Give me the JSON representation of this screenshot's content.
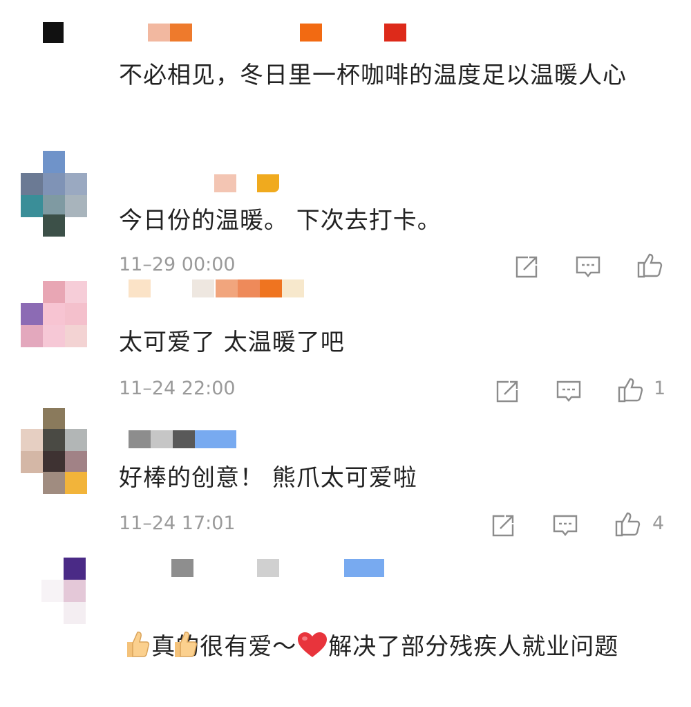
{
  "colors": {
    "text": "#222222",
    "meta": "#9a9a9a",
    "icon": "#8c8c8c",
    "heart": "#e8343c"
  },
  "comments": [
    {
      "text": "不必相见，冬日里一杯咖啡的温度足以温暖人心",
      "time": "",
      "likes": ""
    },
    {
      "text": "今日份的温暖。 下次去打卡。",
      "time": "11–29 00:00",
      "likes": "",
      "icons": [
        "share-icon",
        "comment-icon",
        "like-icon"
      ]
    },
    {
      "text": "太可爱了 太温暖了吧",
      "time": "11–24 22:00",
      "likes": "1",
      "icons": [
        "share-icon",
        "comment-icon",
        "like-icon"
      ]
    },
    {
      "text": "好棒的创意！ 熊爪太可爱啦",
      "time": "11–24 17:01",
      "likes": "4",
      "icons": [
        "share-icon",
        "comment-icon",
        "like-icon"
      ]
    },
    {
      "text_before": "真的很有爱～",
      "text_after": "解决了部分残疾人就业问题",
      "emoji_heart": "❤️",
      "thumbs": "👍 👍",
      "time": "",
      "likes": ""
    }
  ]
}
